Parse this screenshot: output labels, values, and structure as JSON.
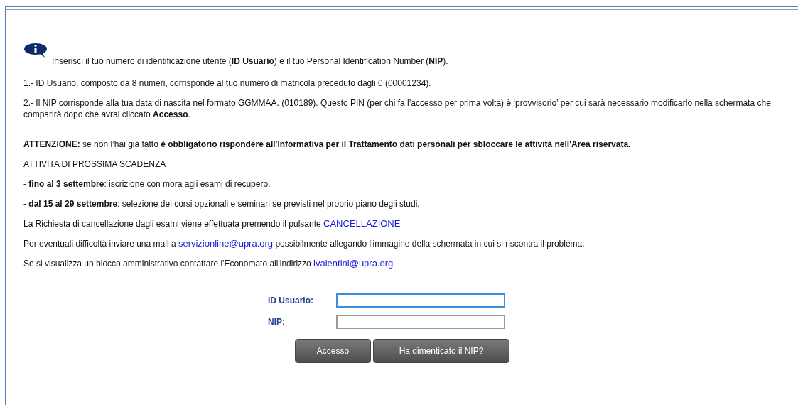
{
  "intro": "Inserisci il tuo numero di identificazione utente (**ID Usuario**) e il tuo Personal Identification Number (**NIP**).",
  "paragraphs": [
    [
      {
        "kind": "text",
        "text": "1.- ID Usuario, composto da 8 numeri, corrisponde al tuo numero di matricola preceduto dagli 0 (00001234)."
      }
    ],
    [
      {
        "kind": "text",
        "text": "2.- Il NIP corrisponde alla tua data di nascita nel formato GGMMAA. (010189). Questo PIN (per chi fa l’accesso per prima volta) è ‘provvisorio’ per cui sarà necessario modificarlo nella schermata che comparirà dopo che avrai cliccato **Accesso**."
      }
    ],
    [
      {
        "kind": "text",
        "text": "**ATTENZIONE:** se non l’hai già fatto **è obbligatorio rispondere all'Informativa per il Trattamento dati personali per sbloccare le attività nell'Area riservata.**"
      }
    ],
    [
      {
        "kind": "text",
        "text": "ATTIVITA DI PROSSIMA SCADENZA"
      }
    ],
    [
      {
        "kind": "text",
        "text": "- **fino al 3 settembre**: iscrizione con mora agli esami di recupero."
      }
    ],
    [
      {
        "kind": "text",
        "text": "- **dal 15 al 29 settembre**: selezione dei corsi opzionali e seminari se previsti nel proprio piano degli studi."
      }
    ],
    [
      {
        "kind": "text",
        "text": "La Richiesta di cancellazione dagli esami viene effettuata premendo il pulsante"
      },
      {
        "kind": "link",
        "text": "CANCELLAZIONE"
      }
    ],
    [
      {
        "kind": "text",
        "text": "Per eventuali difficoltà inviare una mail a"
      },
      {
        "kind": "link",
        "text": "servizionline@upra.org"
      },
      {
        "kind": "text",
        "text": "possibilmente allegando l'immagine della schermata in cui si riscontra il problema."
      }
    ],
    [
      {
        "kind": "text",
        "text": "Se si visualizza un blocco amministrativo contattare l'Economato all'indirizzo"
      },
      {
        "kind": "link",
        "text": "lvalentini@upra.org"
      }
    ]
  ],
  "form": {
    "fields": [
      {
        "label": "ID Usuario:",
        "focused": true
      },
      {
        "label": "NIP:",
        "focused": false
      }
    ],
    "buttons": [
      "Accesso",
      "Ha dimenticato il NIP?"
    ]
  }
}
